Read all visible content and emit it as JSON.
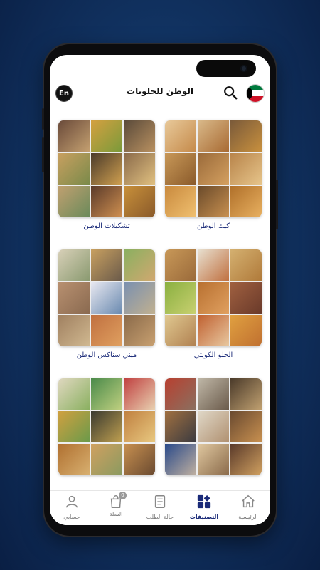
{
  "header": {
    "lang_label": "En",
    "title": "الوطن للحلويات"
  },
  "categories": [
    {
      "label": "كيك الوطن"
    },
    {
      "label": "تشكيلات الوطن"
    },
    {
      "label": "الحلو الكويتي"
    },
    {
      "label": "ميني سناكس الوطن"
    },
    {
      "label": ""
    },
    {
      "label": ""
    }
  ],
  "nav": {
    "home": "الرئيسية",
    "categories": "التصنيفات",
    "order_status": "حالة الطلب",
    "cart": "السلة",
    "cart_count": "0",
    "account": "حسابي"
  },
  "colors": {
    "accent": "#1a2a78",
    "background": "#0a1f44"
  }
}
